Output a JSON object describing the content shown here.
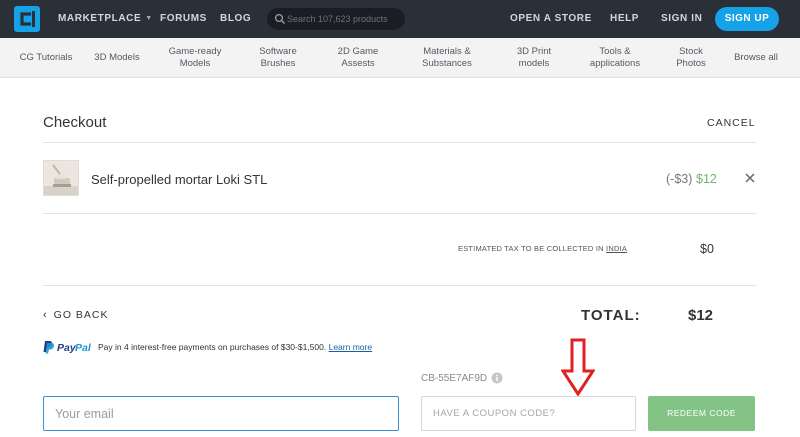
{
  "header": {
    "marketplace_label": "MARKETPLACE",
    "forums_label": "FORUMS",
    "blog_label": "BLOG",
    "search_placeholder": "Search 107,623 products",
    "open_store_label": "OPEN A STORE",
    "help_label": "HELP",
    "sign_in_label": "SIGN IN",
    "sign_up_label": "SIGN UP"
  },
  "categories": [
    {
      "line1": "CG Tutorials",
      "line2": ""
    },
    {
      "line1": "3D Models",
      "line2": ""
    },
    {
      "line1": "Game-ready",
      "line2": "Models"
    },
    {
      "line1": "Software",
      "line2": "Brushes"
    },
    {
      "line1": "2D Game",
      "line2": "Assests"
    },
    {
      "line1": "Materials &",
      "line2": "Substances"
    },
    {
      "line1": "3D Print",
      "line2": "models"
    },
    {
      "line1": "Tools &",
      "line2": "applications"
    },
    {
      "line1": "Stock",
      "line2": "Photos"
    },
    {
      "line1": "Browse all",
      "line2": ""
    }
  ],
  "checkout": {
    "title": "Checkout",
    "cancel_label": "CANCEL",
    "item": {
      "name": "Self-propelled mortar Loki STL",
      "discount": "(-$3)",
      "price": "$12"
    },
    "tax_label": "ESTIMATED TAX TO BE COLLECTED IN",
    "tax_country": "INDIA",
    "tax_value": "$0",
    "go_back_label": "GO BACK",
    "total_label": "TOTAL:",
    "total_value": "$12",
    "paypal_text": "Pay in 4 interest-free payments on purchases of $30-$1,500.",
    "paypal_link": "Learn more",
    "coupon_code": "CB-55E7AF9D",
    "email_placeholder": "Your email",
    "coupon_placeholder": "HAVE A COUPON CODE?",
    "redeem_label": "REDEEM CODE"
  },
  "colors": {
    "nav_bg": "#2b3038",
    "accent_blue": "#15a2e7",
    "price_green": "#6fb56a",
    "redeem_green": "#84c386",
    "annotation_arrow": "#e02020"
  },
  "icons": [
    "logo-icon",
    "chevron-down-icon",
    "search-icon",
    "close-icon",
    "chevron-left-icon",
    "paypal-logo",
    "info-icon",
    "red-down-arrow"
  ]
}
